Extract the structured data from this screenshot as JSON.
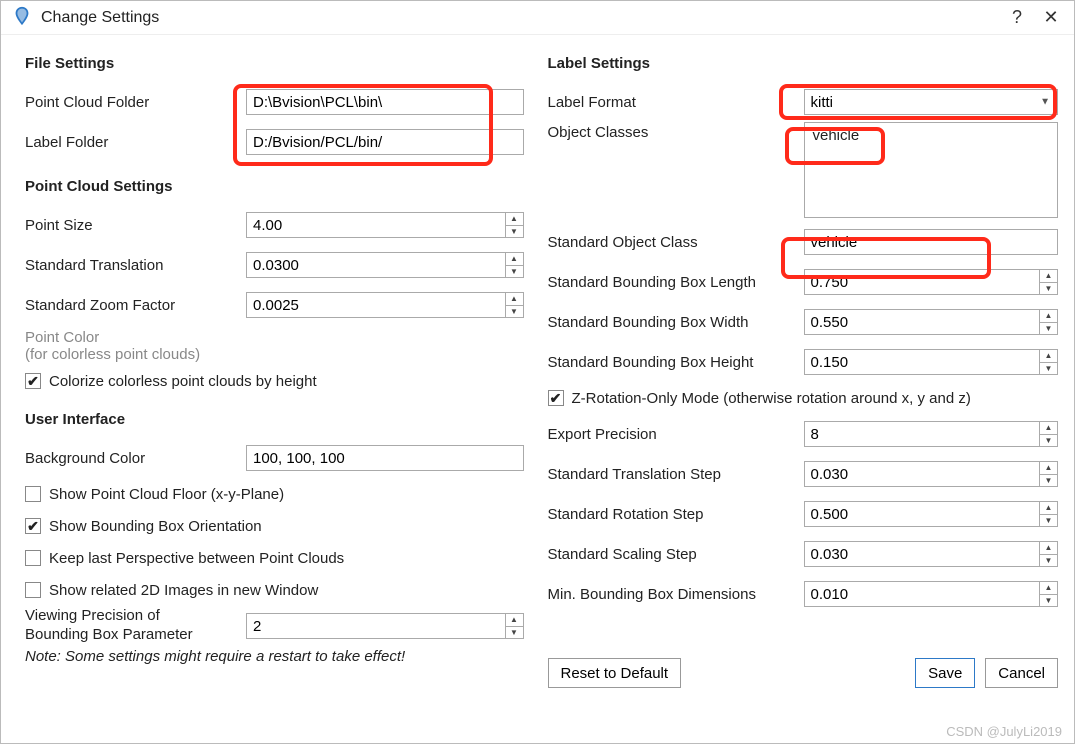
{
  "window": {
    "title": "Change Settings"
  },
  "left": {
    "file_settings": {
      "title": "File Settings",
      "point_cloud_folder_label": "Point Cloud Folder",
      "point_cloud_folder_value": "D:\\Bvision\\PCL\\bin\\",
      "label_folder_label": "Label Folder",
      "label_folder_value": "D:/Bvision/PCL/bin/"
    },
    "pcs": {
      "title": "Point Cloud Settings",
      "point_size_label": "Point Size",
      "point_size_value": "4.00",
      "std_translation_label": "Standard Translation",
      "std_translation_value": "0.0300",
      "std_zoom_label": "Standard Zoom Factor",
      "std_zoom_value": "0.0025",
      "point_color_label": "Point Color",
      "point_color_hint": "(for colorless point clouds)",
      "colorize_label": "Colorize colorless point clouds by height"
    },
    "ui": {
      "title": "User Interface",
      "bg_color_label": "Background Color",
      "bg_color_value": "100, 100, 100",
      "show_floor_label": "Show Point Cloud Floor (x-y-Plane)",
      "show_orientation_label": "Show Bounding Box Orientation",
      "keep_perspective_label": "Keep last Perspective between Point Clouds",
      "show_2d_label": "Show related 2D Images in new Window",
      "viewing_precision_label_line1": "Viewing Precision of",
      "viewing_precision_label_line2": "Bounding Box Parameter",
      "viewing_precision_value": "2",
      "note": "Note: Some settings might require a restart to take effect!"
    }
  },
  "right": {
    "label_settings_title": "Label Settings",
    "label_format_label": "Label Format",
    "label_format_value": "kitti",
    "object_classes_label": "Object Classes",
    "object_classes_item": "vehicle",
    "std_object_class_label": "Standard Object Class",
    "std_object_class_value": "vehicle",
    "bbox_length_label": "Standard Bounding Box Length",
    "bbox_length_value": "0.750",
    "bbox_width_label": "Standard Bounding Box Width",
    "bbox_width_value": "0.550",
    "bbox_height_label": "Standard Bounding Box Height",
    "bbox_height_value": "0.150",
    "zrot_label": "Z-Rotation-Only Mode (otherwise rotation around x, y and z)",
    "export_precision_label": "Export Precision",
    "export_precision_value": "8",
    "std_translation_step_label": "Standard Translation Step",
    "std_translation_step_value": "0.030",
    "std_rotation_step_label": "Standard Rotation Step",
    "std_rotation_step_value": "0.500",
    "std_scaling_step_label": "Standard Scaling Step",
    "std_scaling_step_value": "0.030",
    "min_bbox_dim_label": "Min. Bounding Box Dimensions",
    "min_bbox_dim_value": "0.010",
    "reset_label": "Reset to Default",
    "save_label": "Save",
    "cancel_label": "Cancel"
  },
  "watermark": "CSDN @JulyLi2019"
}
